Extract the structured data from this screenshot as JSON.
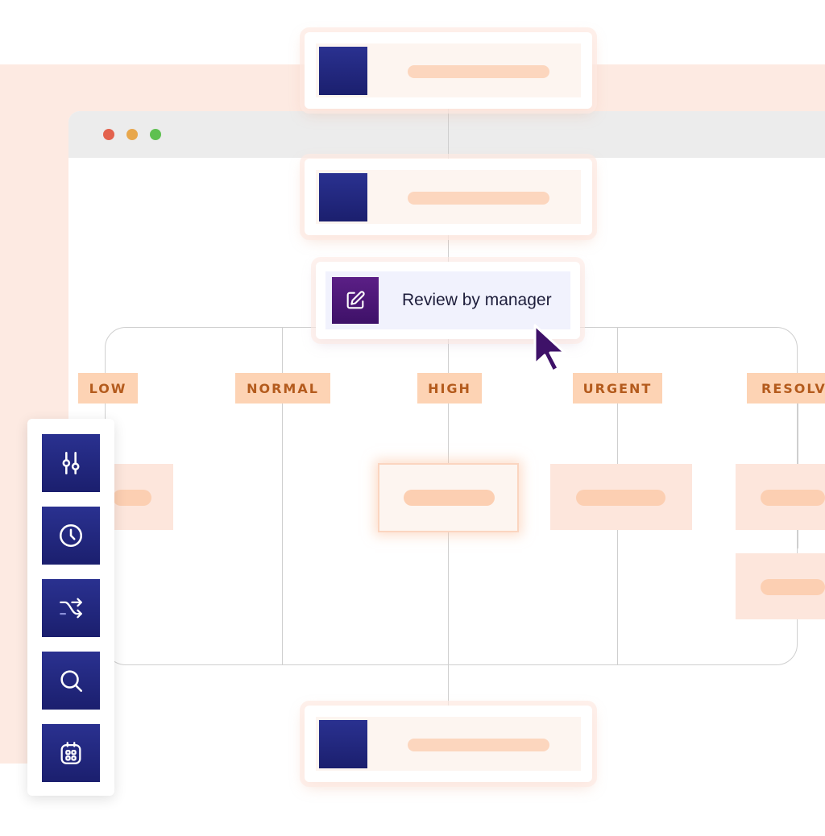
{
  "review_node": {
    "label": "Review by manager",
    "icon": "edit-icon"
  },
  "priority_columns": [
    {
      "label": "LOW"
    },
    {
      "label": "NORMAL"
    },
    {
      "label": "HIGH"
    },
    {
      "label": "URGENT"
    },
    {
      "label": "RESOLVI"
    }
  ],
  "toolbar": {
    "tools": [
      {
        "icon": "sliders-icon"
      },
      {
        "icon": "clock-icon"
      },
      {
        "icon": "shuffle-icon"
      },
      {
        "icon": "search-icon"
      },
      {
        "icon": "calendar-icon"
      }
    ]
  },
  "colors": {
    "accent_navy": "#1b1f6e",
    "accent_purple": "#4a1575",
    "tag_bg": "#fdd3b4",
    "tag_text": "#b45b1d",
    "peach_bg": "#fdeae2"
  }
}
